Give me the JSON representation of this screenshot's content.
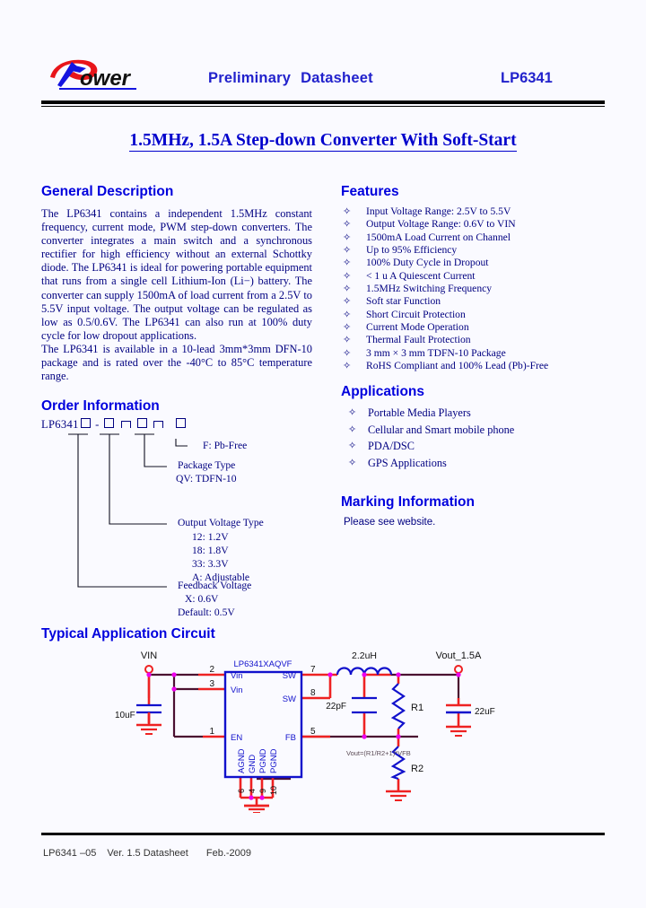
{
  "header": {
    "logo_text": "Power",
    "logo_colors": {
      "red": "#e8151a",
      "blue": "#1414e0",
      "black": "#111111"
    },
    "preliminary": "Preliminary",
    "datasheet": "Datasheet",
    "part_number": "LP6341",
    "accent_color": "#2222cc"
  },
  "doc_title": "1.5MHz, 1.5A Step-down Converter With Soft-Start",
  "sections": {
    "general_description": "General Description",
    "order_information": "Order Information",
    "typical_application_circuit": "Typical Application Circuit",
    "features": "Features",
    "applications": "Applications",
    "marking_information": "Marking Information"
  },
  "general_description": {
    "paragraph1": "The LP6341 contains a independent 1.5MHz constant frequency, current mode, PWM step-down converters. The converter integrates a main switch and a synchronous rectifier for high efficiency without an external Schottky diode. The LP6341 is ideal for powering portable equipment that runs from a single cell Lithium-Ion (Li−) battery. The converter can supply 1500mA of load current from a 2.5V to 5.5V input voltage. The output voltage can be regulated as low as 0.5/0.6V. The LP6341 can also run at 100% duty cycle for low dropout applications.",
    "paragraph2": "The LP6341 is available in a 10-lead 3mm*3mm DFN-10 package and is rated over the -40°C to 85°C temperature range."
  },
  "features": [
    "Input Voltage Range: 2.5V to 5.5V",
    "Output Voltage Range: 0.6V to VIN",
    "1500mA Load Current on Channel",
    "Up to 95% Efficiency",
    "100% Duty Cycle in Dropout",
    "< 1 u A  Quiescent Current",
    "1.5MHz Switching Frequency",
    "Soft star Function",
    "Short Circuit Protection",
    "Current Mode Operation",
    "Thermal Fault Protection",
    "3 mm × 3 mm  TDFN-10 Package",
    "RoHS Compliant and 100% Lead (Pb)-Free"
  ],
  "applications": [
    "Portable Media Players",
    "Cellular and Smart mobile phone",
    "PDA/DSC",
    "GPS Applications"
  ],
  "marking_information": {
    "note": "Please see website."
  },
  "order_information": {
    "part_prefix": "LP6341",
    "dash": "-",
    "labels": {
      "pb_free": "F: Pb-Free",
      "package_type_title": "Package Type",
      "package_type_value": "QV: TDFN-10",
      "output_voltage_title": "Output Voltage Type",
      "output_voltage_options": [
        "12: 1.2V",
        "18: 1.8V",
        "33: 3.3V",
        "A:   Adjustable"
      ],
      "feedback_voltage_title": "Feedback Voltage",
      "feedback_voltage_options": [
        "X:          0.6V",
        "Default:   0.5V"
      ]
    }
  },
  "circuit": {
    "ic_label": "LP6341XAQVF",
    "vin_label": "VIN",
    "vout_label": "Vout_1.5A",
    "input_cap": "10uF",
    "inductor": "2.2uH",
    "feedforward_cap": "22pF",
    "output_cap": "22uF",
    "r1": "R1",
    "r2": "R2",
    "formula": "Vout=(R1/R2+1)*VFB",
    "pins": {
      "left": [
        {
          "num": "2",
          "name": "Vin"
        },
        {
          "num": "3",
          "name": "Vin"
        },
        {
          "num": "1",
          "name": "EN"
        }
      ],
      "right": [
        {
          "num": "7",
          "name": "SW"
        },
        {
          "num": "8",
          "name": "SW"
        },
        {
          "num": "5",
          "name": "FB"
        }
      ],
      "bottom": [
        {
          "num": "6",
          "name": "AGND"
        },
        {
          "num": "4",
          "name": "GND"
        },
        {
          "num": "9",
          "name": "PGND"
        },
        {
          "num": "10",
          "name": "PGND"
        }
      ]
    },
    "colors": {
      "wire_red": "#ee2222",
      "wire_dark": "#4a1030",
      "ic_blue": "#1111cc",
      "node_magenta": "#ee00ee"
    }
  },
  "footer": {
    "part": "LP6341 –05",
    "version": "Ver. 1.5 Datasheet",
    "date": "Feb.-2009"
  }
}
